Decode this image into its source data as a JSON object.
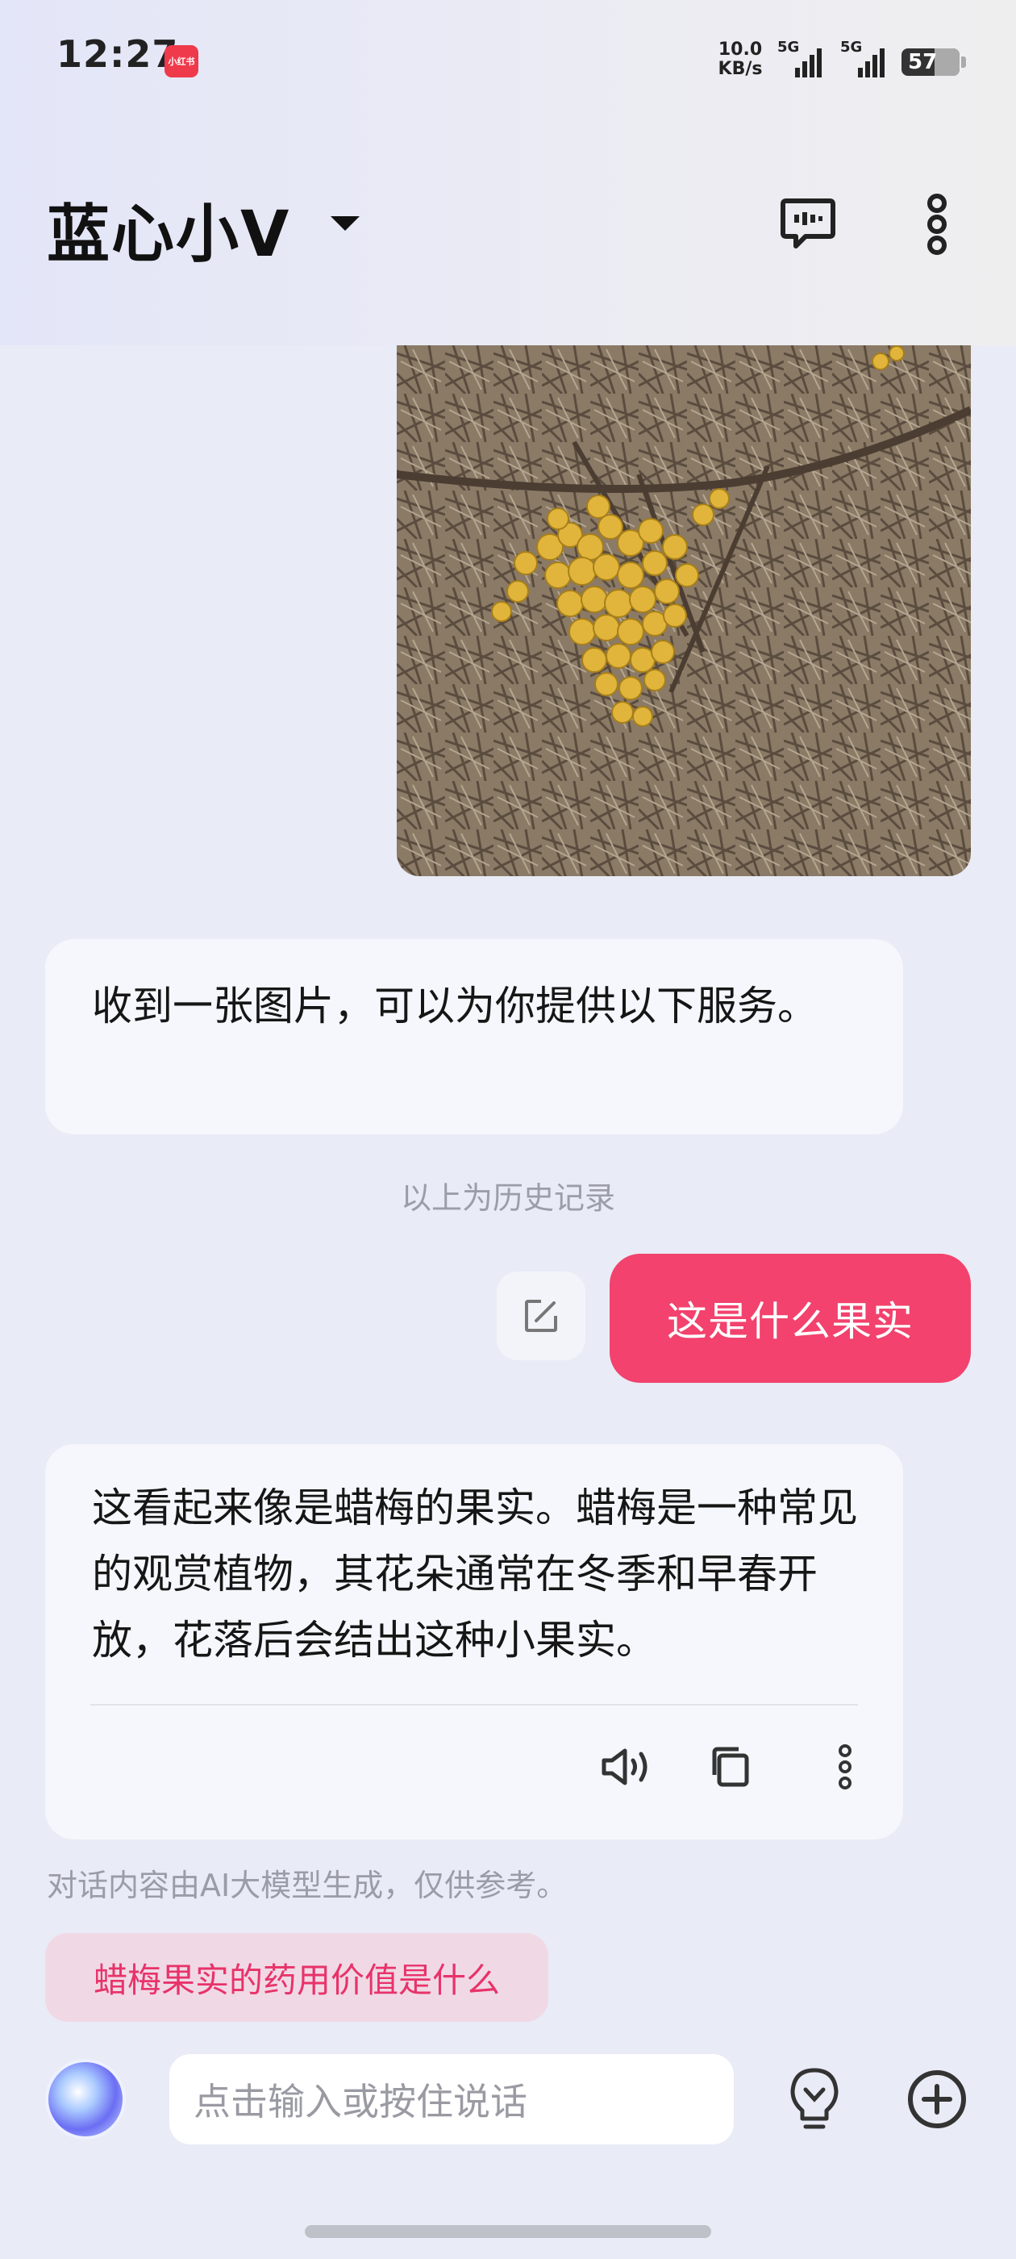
{
  "status_bar": {
    "time": "12:27",
    "app_badge": "小红书",
    "net_speed_value": "10.0",
    "net_speed_unit": "KB/s",
    "signal1_label": "5G",
    "signal2_label": "5G",
    "battery": "57"
  },
  "header": {
    "title": "蓝心小V"
  },
  "messages": {
    "ai_1": "收到一张图片，可以为你提供以下服务。",
    "history_divider": "以上为历史记录",
    "user_1": "这是什么果实",
    "ai_2": "这看起来像是蜡梅的果实。蜡梅是一种常见的观赏植物，其花朵通常在冬季和早春开放，花落后会结出这种小果实。"
  },
  "disclaimer": "对话内容由AI大模型生成，仅供参考。",
  "suggestion": "蜡梅果实的药用价值是什么",
  "input": {
    "placeholder": "点击输入或按住说话"
  },
  "colors": {
    "accent": "#f2426d",
    "background": "#e9ebf6",
    "suggest_bg": "#f0d9e5"
  }
}
